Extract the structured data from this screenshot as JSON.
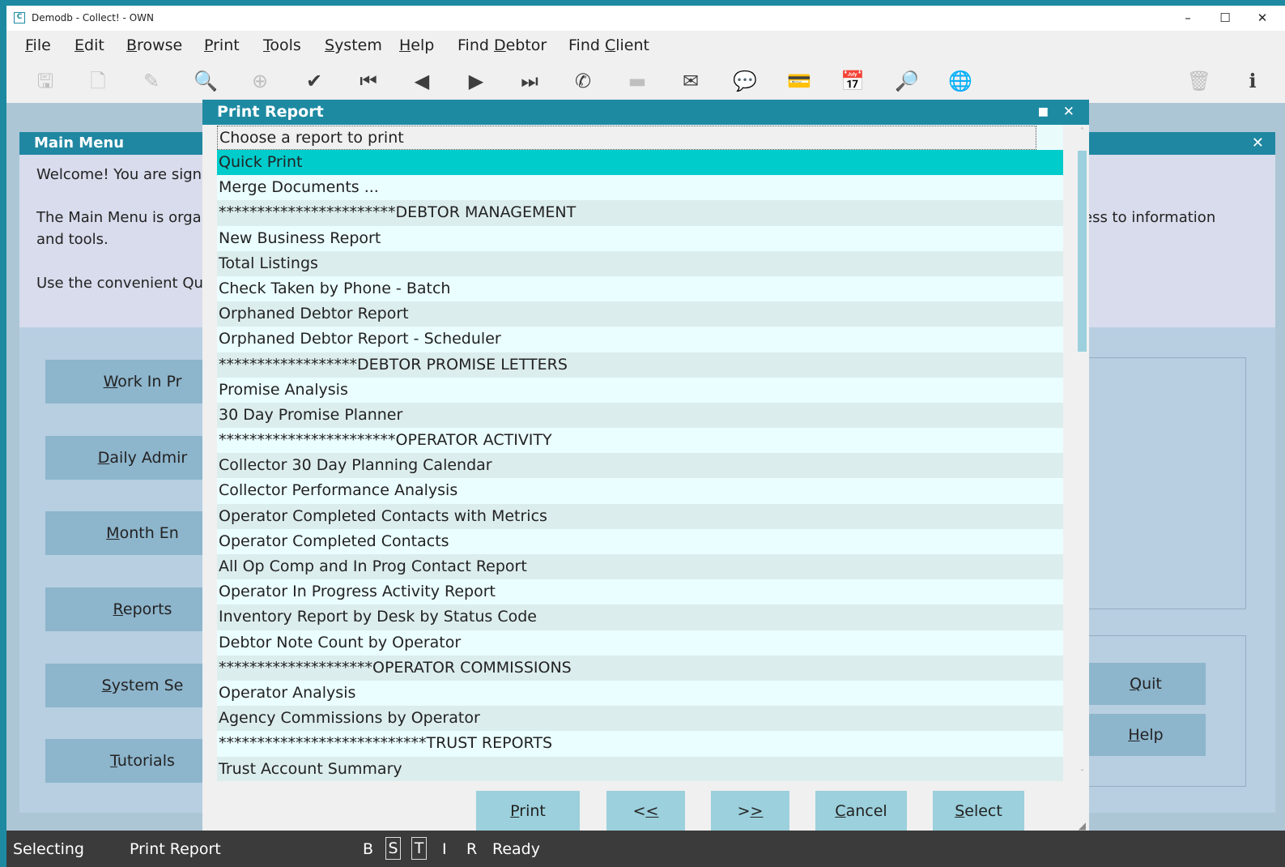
{
  "window": {
    "title": "Demodb - Collect! - OWN",
    "icon_letter": "C",
    "minimize": "–",
    "maximize": "☐",
    "close": "✕"
  },
  "menu": [
    {
      "pre": "",
      "u": "F",
      "post": "ile"
    },
    {
      "pre": "",
      "u": "E",
      "post": "dit"
    },
    {
      "pre": "",
      "u": "B",
      "post": "rowse"
    },
    {
      "pre": "",
      "u": "P",
      "post": "rint"
    },
    {
      "pre": "",
      "u": "T",
      "post": "ools"
    },
    {
      "pre": "",
      "u": "S",
      "post": "ystem"
    },
    {
      "pre": "",
      "u": "H",
      "post": "elp"
    },
    {
      "pre": "Find ",
      "u": "D",
      "post": "ebtor"
    },
    {
      "pre": "Find ",
      "u": "C",
      "post": "lient"
    }
  ],
  "toolbar_icons": [
    {
      "name": "save-icon",
      "glyph": "🖫",
      "enabled": false
    },
    {
      "name": "new-document-icon",
      "glyph": "🗋",
      "enabled": false
    },
    {
      "name": "edit-document-icon",
      "glyph": "✎",
      "enabled": false
    },
    {
      "name": "preview-document-icon",
      "glyph": "🔍",
      "enabled": false
    },
    {
      "name": "binoculars-icon",
      "glyph": "⊕",
      "enabled": false
    },
    {
      "name": "checkmark-icon",
      "glyph": "✔",
      "enabled": true
    },
    {
      "name": "first-record-icon",
      "glyph": "⏮",
      "enabled": true
    },
    {
      "name": "previous-record-icon",
      "glyph": "◀",
      "enabled": true
    },
    {
      "name": "next-record-icon",
      "glyph": "▶",
      "enabled": true
    },
    {
      "name": "last-record-icon",
      "glyph": "⏭",
      "enabled": true
    },
    {
      "name": "phone-icon",
      "glyph": "✆",
      "enabled": true
    },
    {
      "name": "inbox-tray-icon",
      "glyph": "▬",
      "enabled": false
    },
    {
      "name": "envelope-icon",
      "glyph": "✉",
      "enabled": true
    },
    {
      "name": "chat-bubble-icon",
      "glyph": "💬",
      "enabled": true
    },
    {
      "name": "payment-card-icon",
      "glyph": "💳",
      "enabled": true
    },
    {
      "name": "calendar-add-icon",
      "glyph": "📅",
      "enabled": true
    },
    {
      "name": "search-icon",
      "glyph": "🔎",
      "enabled": true
    },
    {
      "name": "globe-icon",
      "glyph": "🌐",
      "enabled": true
    },
    {
      "name": "trash-icon",
      "glyph": "🗑",
      "enabled": false
    },
    {
      "name": "info-icon",
      "glyph": "ℹ",
      "enabled": true
    }
  ],
  "main_menu": {
    "title": "Main Menu",
    "close": "✕",
    "intro_line1": "Welcome! You are sign",
    "intro_line2": "The Main Menu is orga",
    "intro_line2_right": "ess to information",
    "intro_line3": "and tools.",
    "intro_line4": "Use the convenient Qu",
    "buttons": [
      {
        "u": "W",
        "post": "ork In Pr"
      },
      {
        "u": "D",
        "post": "aily Admir"
      },
      {
        "u": "M",
        "post": "onth En"
      },
      {
        "u": "R",
        "post": "eports"
      },
      {
        "u": "S",
        "post": "ystem Se"
      },
      {
        "u": "T",
        "post": "utorials"
      }
    ],
    "quit": {
      "u": "Q",
      "post": "uit"
    },
    "help": {
      "u": "H",
      "post": "elp"
    }
  },
  "dialog": {
    "title": "Print Report",
    "maximize": "■",
    "close": "✕",
    "selected_index": 1,
    "items": [
      "Choose a report to print",
      "Quick Print",
      "Merge Documents ...",
      "***********************DEBTOR MANAGEMENT",
      "New Business Report",
      "Total Listings",
      "Check Taken by Phone - Batch",
      "Orphaned Debtor Report",
      "Orphaned Debtor Report - Scheduler",
      "******************DEBTOR PROMISE LETTERS",
      "Promise Analysis",
      "30 Day Promise Planner",
      "***********************OPERATOR ACTIVITY",
      "Collector 30 Day Planning Calendar",
      "Collector Performance Analysis",
      "Operator Completed Contacts with Metrics",
      "Operator Completed Contacts",
      "All Op Comp and In Prog Contact Report",
      "Operator In Progress Activity Report",
      "Inventory Report by Desk by Status Code",
      "Debtor Note Count by Operator",
      "********************OPERATOR COMMISSIONS",
      "Operator Analysis",
      "Agency Commissions by Operator",
      "***************************TRUST REPORTS",
      "Trust Account Summary"
    ],
    "scroll_up": "˄",
    "scroll_down": "˅",
    "buttons": {
      "print": {
        "pre": "",
        "u": "P",
        "post": "rint"
      },
      "prev": {
        "pre": "<",
        "u": "<",
        "post": ""
      },
      "next": {
        "pre": ">",
        "u": ">",
        "post": ""
      },
      "cancel": {
        "pre": "",
        "u": "C",
        "post": "ancel"
      },
      "select": {
        "pre": "",
        "u": "S",
        "post": "elect"
      }
    },
    "grip": "◢"
  },
  "status": {
    "mode": "Selecting",
    "screen": "Print Report",
    "flag_b": "B",
    "flag_s": "S",
    "flag_t": "T",
    "flag_i": "I",
    "flag_r": "R",
    "state": "Ready"
  }
}
